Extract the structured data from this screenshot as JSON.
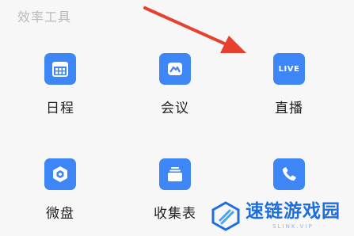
{
  "section": {
    "title": "效率工具"
  },
  "tools": [
    {
      "label": "日程",
      "icon": "calendar-icon"
    },
    {
      "label": "会议",
      "icon": "meeting-icon"
    },
    {
      "label": "直播",
      "icon": "live-icon",
      "badge": "LIVE"
    },
    {
      "label": "微盘",
      "icon": "drive-icon"
    },
    {
      "label": "收集表",
      "icon": "form-icon"
    },
    {
      "label": "",
      "icon": "phone-icon"
    }
  ],
  "watermark": {
    "title": "速链游戏园",
    "subtitle": "SLINK.VIP"
  },
  "colors": {
    "accent": "#3e86f5",
    "arrow": "#e8402f",
    "background": "#f7f7f7"
  }
}
